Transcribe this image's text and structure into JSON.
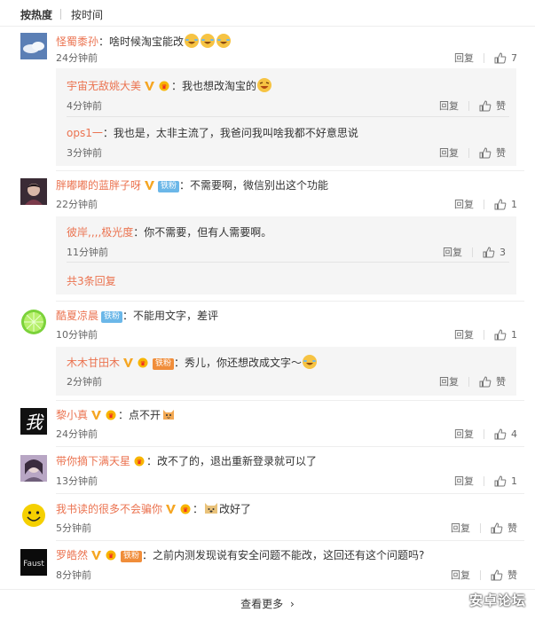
{
  "tabs": {
    "hot": "按热度",
    "time": "按时间"
  },
  "actions": {
    "reply": "回复",
    "like": "赞"
  },
  "comments": [
    {
      "user": "怪蜀黍孙",
      "text": "啥时候淘宝能改",
      "time": "24分钟前",
      "likes": "7",
      "replies": [
        {
          "user": "宇宙无敌姚大美",
          "text": "我也想改淘宝的",
          "time": "4分钟前",
          "likes": "赞"
        },
        {
          "user": "ops1一",
          "text": "我也是，太非主流了，我爸问我叫啥我都不好意思说",
          "time": "3分钟前",
          "likes": "赞"
        }
      ]
    },
    {
      "user": "胖嘟嘟的蓝胖子呀",
      "fan": "铁粉",
      "text": "不需要啊，微信别出这个功能",
      "time": "22分钟前",
      "likes": "1",
      "replies": [
        {
          "user": "彼岸,,,,极光度",
          "text": "你不需要，但有人需要啊。",
          "time": "11分钟前",
          "likes": "3"
        }
      ],
      "more_replies": "共3条回复"
    },
    {
      "user": "酷夏凉晨",
      "fan": "铁粉",
      "text": "不能用文字，差评",
      "time": "10分钟前",
      "likes": "1",
      "replies": [
        {
          "user": "木木甘田木",
          "fan": "铁粉",
          "text": "秀儿，你还想改成文字～",
          "time": "2分钟前",
          "likes": "赞"
        }
      ]
    },
    {
      "user": "黎小真",
      "text": "点不开",
      "time": "24分钟前",
      "likes": "4"
    },
    {
      "user": "带你摘下满天星",
      "text": "改不了的，退出重新登录就可以了",
      "time": "13分钟前",
      "likes": "1"
    },
    {
      "user": "我书读的很多不会骗你",
      "text": "改好了",
      "time": "5分钟前",
      "likes": "赞"
    },
    {
      "user": "罗皓然",
      "fan": "铁粉",
      "text": "之前内测发现说有安全问题不能改，这回还有这个问题吗?",
      "time": "8分钟前",
      "likes": "赞"
    }
  ],
  "avatar_texts": {
    "li": "我",
    "faust": "Faust"
  },
  "footer": {
    "load_more": "查看更多"
  },
  "watermark": "安卓论坛"
}
